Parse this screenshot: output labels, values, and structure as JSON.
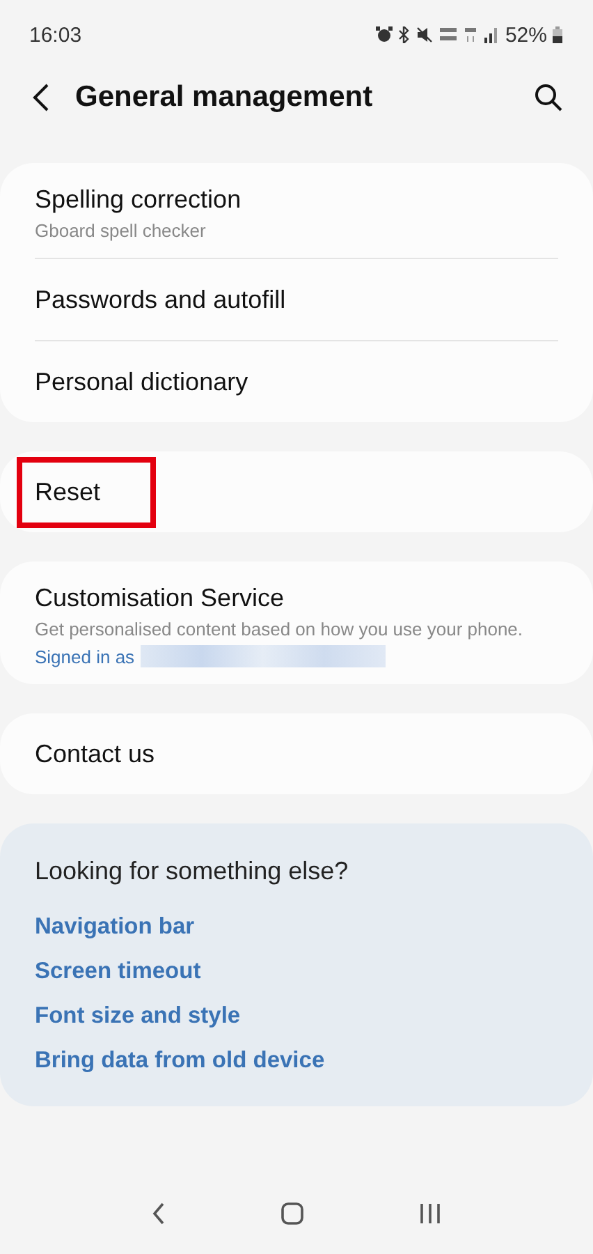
{
  "status_bar": {
    "time": "16:03",
    "battery": "52%"
  },
  "header": {
    "title": "General management"
  },
  "groups": [
    {
      "items": [
        {
          "title": "Spelling correction",
          "subtitle": "Gboard spell checker",
          "highlighted": false
        },
        {
          "title": "Passwords and autofill",
          "highlighted": false
        },
        {
          "title": "Personal dictionary",
          "highlighted": false
        }
      ]
    },
    {
      "items": [
        {
          "title": "Reset",
          "highlighted": true
        }
      ]
    },
    {
      "items": [
        {
          "title": "Customisation Service",
          "subtitle": "Get personalised content based on how you use your phone.",
          "account_label": "Signed in as",
          "account_redacted": true,
          "highlighted": false
        }
      ]
    },
    {
      "items": [
        {
          "title": "Contact us",
          "highlighted": false
        }
      ]
    }
  ],
  "suggestions": {
    "title": "Looking for something else?",
    "links": [
      "Navigation bar",
      "Screen timeout",
      "Font size and style",
      "Bring data from old device"
    ]
  }
}
